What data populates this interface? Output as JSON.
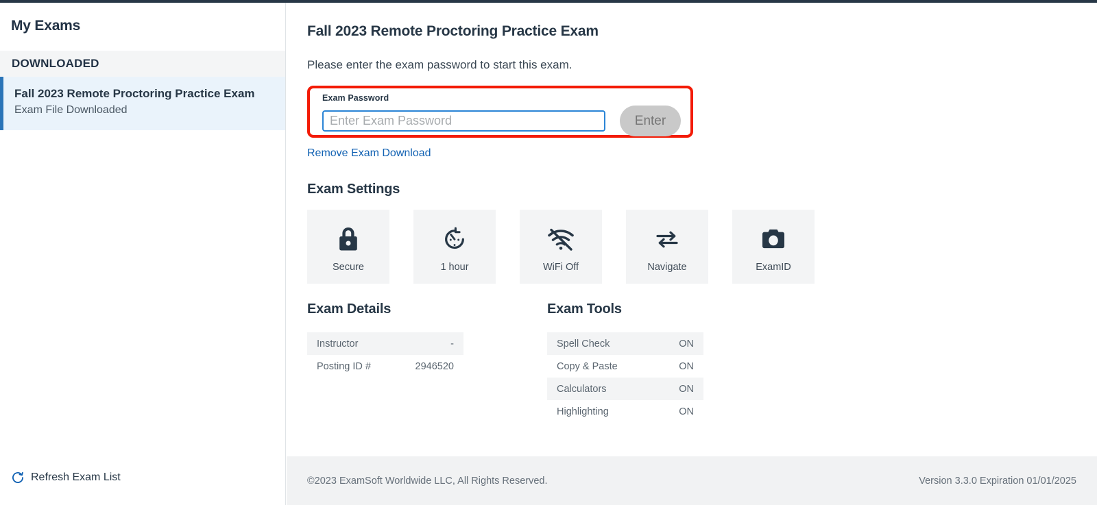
{
  "sidebar": {
    "title": "My Exams",
    "section_label": "DOWNLOADED",
    "exam": {
      "title": "Fall 2023 Remote Proctoring Practice Exam",
      "status": "Exam File Downloaded"
    },
    "refresh_label": "Refresh Exam List",
    "refresh_icon": "refresh-icon",
    "accent_color": "#2a74b8"
  },
  "main": {
    "title": "Fall 2023 Remote Proctoring Practice Exam",
    "subtitle": "Please enter the exam password to start this exam.",
    "password_form": {
      "label": "Exam Password",
      "placeholder": "Enter Exam Password",
      "value": "",
      "submit_label": "Enter",
      "highlight_color": "#f31b06",
      "input_border_color": "#2b85d6"
    },
    "remove_link": "Remove Exam Download",
    "settings": {
      "heading": "Exam Settings",
      "cards": [
        {
          "icon": "lock-icon",
          "label": "Secure"
        },
        {
          "icon": "timer-icon",
          "label": "1 hour"
        },
        {
          "icon": "wifi-off-icon",
          "label": "WiFi Off"
        },
        {
          "icon": "navigate-icon",
          "label": "Navigate"
        },
        {
          "icon": "camera-icon",
          "label": "ExamID"
        }
      ]
    },
    "details": {
      "heading": "Exam Details",
      "rows": [
        {
          "label": "Instructor",
          "value": "-"
        },
        {
          "label": "Posting ID #",
          "value": "2946520"
        }
      ]
    },
    "tools": {
      "heading": "Exam Tools",
      "rows": [
        {
          "label": "Spell Check",
          "value": "ON"
        },
        {
          "label": "Copy & Paste",
          "value": "ON"
        },
        {
          "label": "Calculators",
          "value": "ON"
        },
        {
          "label": "Highlighting",
          "value": "ON"
        }
      ]
    }
  },
  "footer": {
    "copyright": "©2023 ExamSoft Worldwide LLC, All Rights Reserved.",
    "version": "Version 3.3.0 Expiration 01/01/2025"
  }
}
